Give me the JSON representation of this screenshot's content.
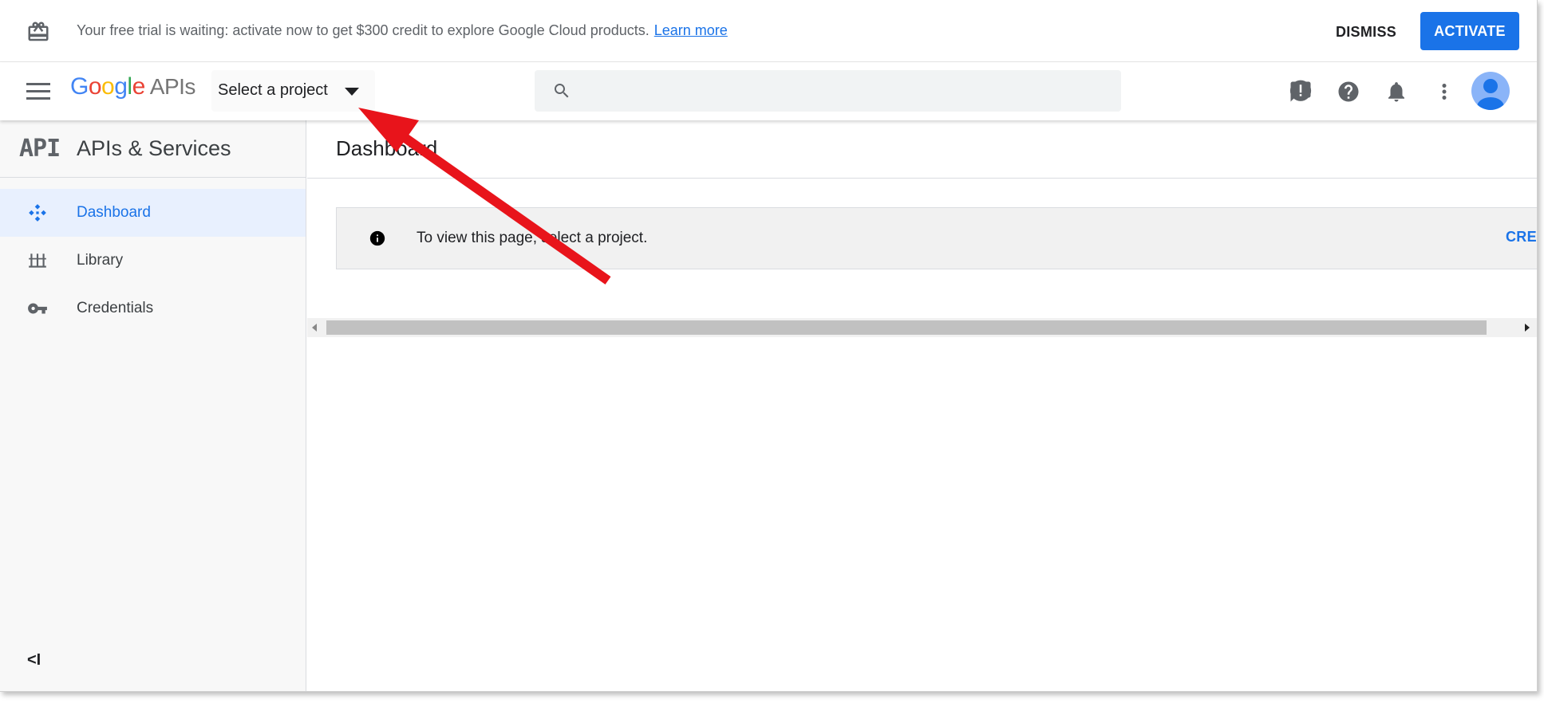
{
  "banner": {
    "message": "Your free trial is waiting: activate now to get $300 credit to explore Google Cloud products.",
    "learn_more": "Learn more",
    "dismiss_label": "DISMISS",
    "activate_label": "ACTIVATE",
    "icon": "gift-icon"
  },
  "header": {
    "logo_google": [
      "G",
      "o",
      "o",
      "g",
      "l",
      "e"
    ],
    "logo_apis": "APIs",
    "project_selector": "Select a project",
    "search_placeholder": "",
    "icons": [
      "menu-icon",
      "search-icon",
      "feedback-icon",
      "help-icon",
      "notifications-icon",
      "more-vert-icon",
      "avatar"
    ]
  },
  "sidebar": {
    "logo": "API",
    "title": "APIs & Services",
    "items": [
      {
        "label": "Dashboard",
        "icon": "dashboard-icon",
        "active": true
      },
      {
        "label": "Library",
        "icon": "library-icon",
        "active": false
      },
      {
        "label": "Credentials",
        "icon": "key-icon",
        "active": false
      }
    ],
    "collapse_label": "<I"
  },
  "main": {
    "page_title": "Dashboard",
    "notice_text": "To view this page, select a project.",
    "create_label": "CREATE"
  },
  "colors": {
    "accent": "#1a73e8",
    "active_nav_bg": "#e8f0fe",
    "annotation_arrow": "#e8141b",
    "google_blue": "#4285f4",
    "google_red": "#ea4335",
    "google_yellow": "#fbbc05",
    "google_green": "#34a853"
  }
}
